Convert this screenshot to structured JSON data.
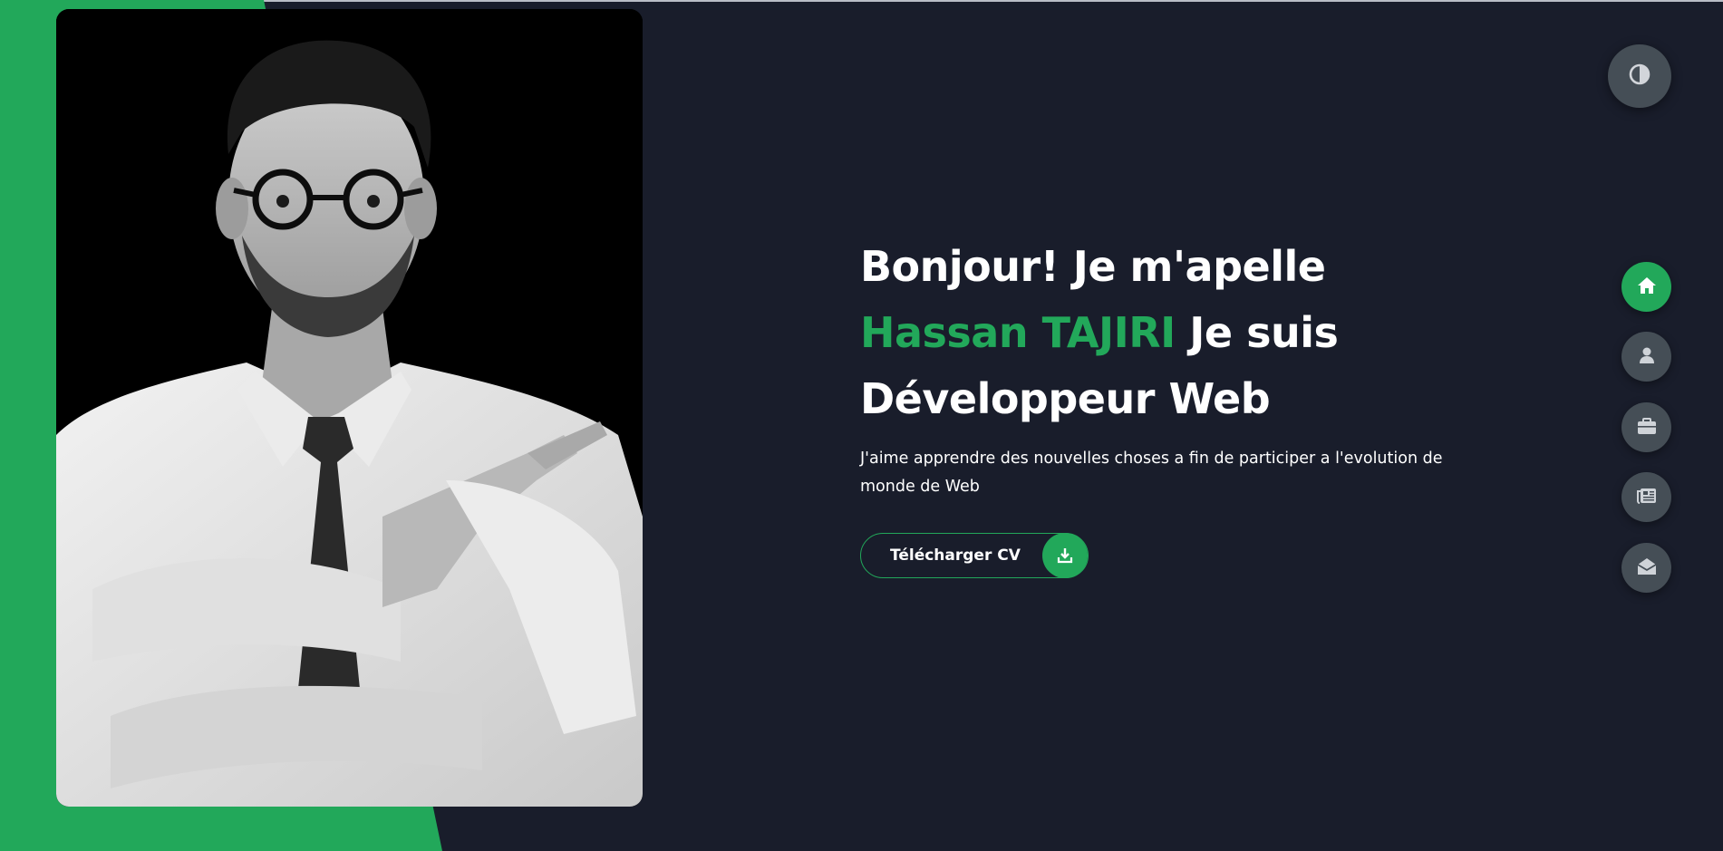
{
  "hero": {
    "title_line1": "Bonjour! Je m'apelle",
    "name": "Hassan TAJIRI",
    "title_line2_rest": " Je suis",
    "title_line3": "Développeur Web",
    "description": "J'aime apprendre des nouvelles choses a fin de participer a l'evolution de monde de Web",
    "cv_button_label": "Télécharger CV",
    "cv_button_icon": "download-icon"
  },
  "theme_toggle": {
    "icon": "contrast-icon"
  },
  "nav": {
    "items": [
      {
        "icon": "home-icon",
        "active": true
      },
      {
        "icon": "user-icon",
        "active": false
      },
      {
        "icon": "briefcase-icon",
        "active": false
      },
      {
        "icon": "newspaper-icon",
        "active": false
      },
      {
        "icon": "envelope-open-icon",
        "active": false
      }
    ]
  },
  "colors": {
    "background": "#191d2b",
    "accent": "#22a85a",
    "button_gray": "#454e56",
    "text": "#ffffff"
  }
}
